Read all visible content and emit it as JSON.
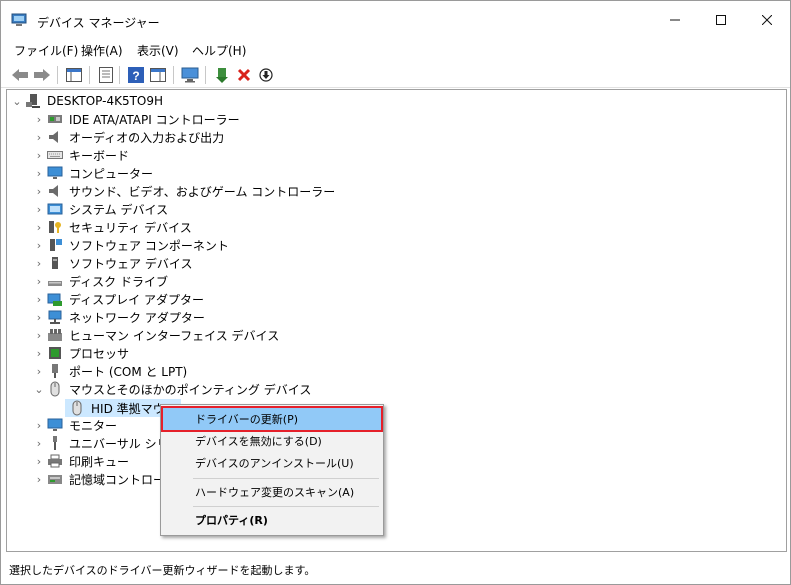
{
  "window": {
    "title": "デバイス マネージャー"
  },
  "menubar": {
    "file": "ファイル(F)",
    "action": "操作(A)",
    "view": "表示(V)",
    "help": "ヘルプ(H)"
  },
  "tree": {
    "root": "DESKTOP-4K5TO9H",
    "categories": [
      "IDE ATA/ATAPI コントローラー",
      "オーディオの入力および出力",
      "キーボード",
      "コンピューター",
      "サウンド、ビデオ、およびゲーム コントローラー",
      "システム デバイス",
      "セキュリティ デバイス",
      "ソフトウェア コンポーネント",
      "ソフトウェア デバイス",
      "ディスク ドライブ",
      "ディスプレイ アダプター",
      "ネットワーク アダプター",
      "ヒューマン インターフェイス デバイス",
      "プロセッサ",
      "ポート (COM と LPT)",
      "マウスとそのほかのポインティング デバイス",
      "モニター",
      "ユニバーサル シリアル",
      "印刷キュー",
      "記憶域コントローラー"
    ],
    "selected_child": "HID 準拠マウス"
  },
  "context_menu": {
    "update_driver": "ドライバーの更新(P)",
    "disable_device": "デバイスを無効にする(D)",
    "uninstall_device": "デバイスのアンインストール(U)",
    "scan_hardware": "ハードウェア変更のスキャン(A)",
    "properties": "プロパティ(R)"
  },
  "status": {
    "text": "選択したデバイスのドライバー更新ウィザードを起動します。"
  },
  "colors": {
    "highlight": "#91c9f7",
    "annotation_box": "#e5202a",
    "selection": "#cce8ff"
  }
}
